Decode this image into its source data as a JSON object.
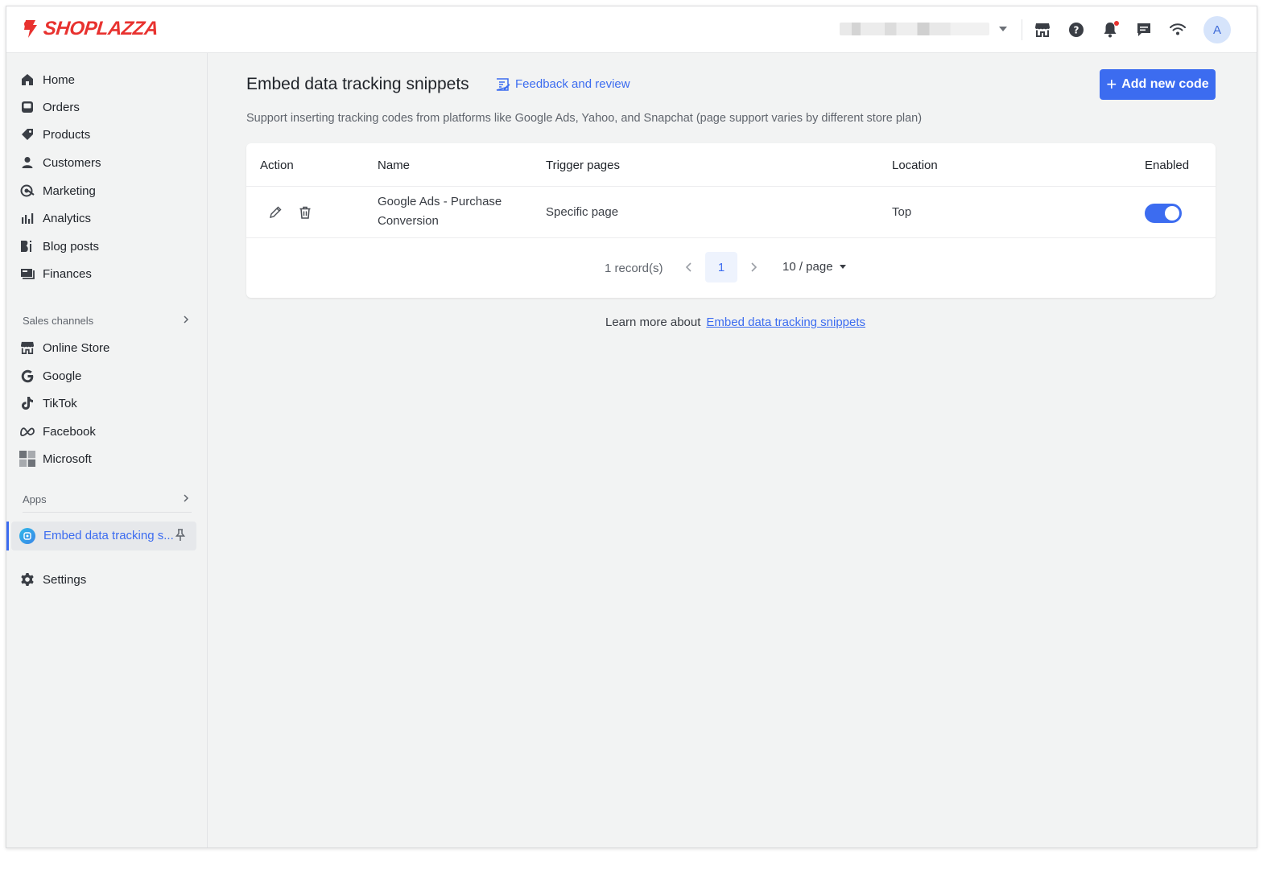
{
  "brand": {
    "name": "SHOPLAZZA",
    "color": "#e8322f"
  },
  "accent": "#3c6cf0",
  "header": {
    "icons": [
      "store-icon",
      "help-icon",
      "bell-icon",
      "chat-icon",
      "wifi-icon"
    ],
    "avatar_initial": "A"
  },
  "sidebar": {
    "items": [
      {
        "label": "Home",
        "icon": "home-icon"
      },
      {
        "label": "Orders",
        "icon": "orders-icon"
      },
      {
        "label": "Products",
        "icon": "tag-icon"
      },
      {
        "label": "Customers",
        "icon": "person-icon"
      },
      {
        "label": "Marketing",
        "icon": "marketing-icon"
      },
      {
        "label": "Analytics",
        "icon": "bar-chart-icon"
      },
      {
        "label": "Blog posts",
        "icon": "blog-icon"
      },
      {
        "label": "Finances",
        "icon": "finances-icon"
      }
    ],
    "sales_channels_title": "Sales channels",
    "sales_channels": [
      {
        "label": "Online Store",
        "icon": "store-icon"
      },
      {
        "label": "Google",
        "icon": "google-icon"
      },
      {
        "label": "TikTok",
        "icon": "tiktok-icon"
      },
      {
        "label": "Facebook",
        "icon": "meta-icon"
      },
      {
        "label": "Microsoft",
        "icon": "microsoft-icon"
      }
    ],
    "apps_title": "Apps",
    "active_app": "Embed data tracking s...",
    "settings": "Settings"
  },
  "main": {
    "title": "Embed data tracking snippets",
    "feedback_link": "Feedback and review",
    "add_button": "Add new code",
    "subtitle": "Support inserting tracking codes from platforms like Google Ads, Yahoo, and Snapchat (page support varies by different store plan)",
    "table": {
      "columns": [
        "Action",
        "Name",
        "Trigger pages",
        "Location",
        "Enabled"
      ],
      "rows": [
        {
          "name_line1": "Google Ads - Purchase",
          "name_line2": "Conversion",
          "trigger_pages": "Specific page",
          "location": "Top",
          "enabled": true
        }
      ]
    },
    "pagination": {
      "records": "1 record(s)",
      "current_page": "1",
      "page_size": "10 / page"
    },
    "learn_more_prefix": "Learn more about",
    "learn_more_link": "Embed data tracking snippets"
  }
}
